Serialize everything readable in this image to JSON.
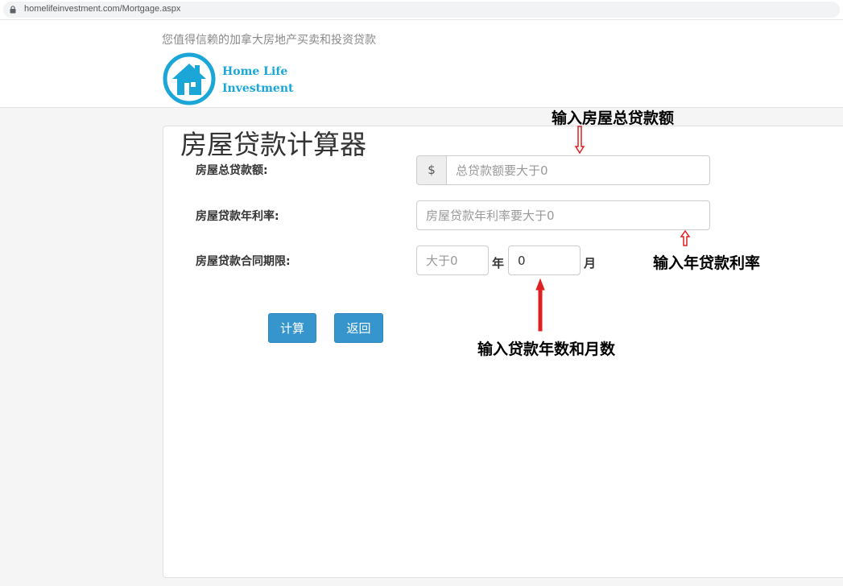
{
  "browser": {
    "url": "homelifeinvestment.com/Mortgage.aspx"
  },
  "header": {
    "tagline": "您值得信赖的加拿大房地产买卖和投资贷款",
    "brand_line1": "Home Life",
    "brand_line2": "Investment"
  },
  "form": {
    "title": "房屋贷款计算器",
    "loan_amount": {
      "label": "房屋总贷款额:",
      "prefix": "$",
      "placeholder": "总贷款额要大于0",
      "value": ""
    },
    "interest_rate": {
      "label": "房屋贷款年利率:",
      "placeholder": "房屋贷款年利率要大于0",
      "value": ""
    },
    "term": {
      "label": "房屋贷款合同期限:",
      "years_placeholder": "大于0",
      "years_value": "",
      "years_unit": "年",
      "months_value": "0",
      "months_unit": "月"
    },
    "calculate_label": "计算",
    "back_label": "返回"
  },
  "annotations": {
    "loan_amount": "输入房屋总贷款额",
    "interest_rate": "输入年贷款利率",
    "term": "输入贷款年数和月数"
  },
  "colors": {
    "accent": "#3795cd",
    "logo": "#1aa7d8",
    "annotation_arrow": "#e02020"
  }
}
